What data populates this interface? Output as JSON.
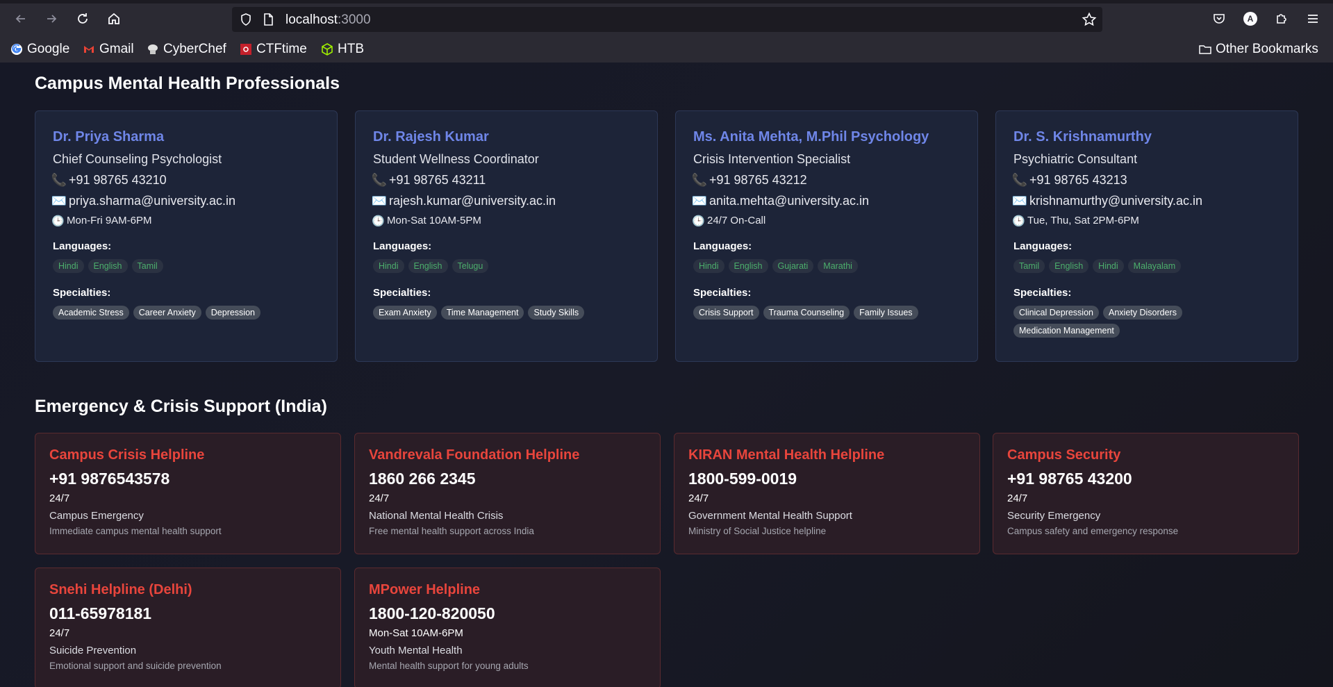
{
  "browser": {
    "url_host": "localhost",
    "url_port": ":3000",
    "bookmarks": [
      {
        "label": "Google",
        "icon": "google-icon"
      },
      {
        "label": "Gmail",
        "icon": "gmail-icon"
      },
      {
        "label": "CyberChef",
        "icon": "cyberchef-icon"
      },
      {
        "label": "CTFtime",
        "icon": "ctftime-icon"
      },
      {
        "label": "HTB",
        "icon": "htb-icon"
      }
    ],
    "other_bookmarks": "Other Bookmarks",
    "account_initial": "A"
  },
  "professionals": {
    "title": "Campus Mental Health Professionals",
    "languages_label": "Languages:",
    "specialties_label": "Specialties:",
    "items": [
      {
        "name": "Dr. Priya Sharma",
        "role": "Chief Counseling Psychologist",
        "phone": "+91 98765 43210",
        "email": "priya.sharma@university.ac.in",
        "hours": "Mon-Fri 9AM-6PM",
        "languages": [
          "Hindi",
          "English",
          "Tamil"
        ],
        "specialties": [
          "Academic Stress",
          "Career Anxiety",
          "Depression"
        ]
      },
      {
        "name": "Dr. Rajesh Kumar",
        "role": "Student Wellness Coordinator",
        "phone": "+91 98765 43211",
        "email": "rajesh.kumar@university.ac.in",
        "hours": "Mon-Sat 10AM-5PM",
        "languages": [
          "Hindi",
          "English",
          "Telugu"
        ],
        "specialties": [
          "Exam Anxiety",
          "Time Management",
          "Study Skills"
        ]
      },
      {
        "name": "Ms. Anita Mehta, M.Phil Psychology",
        "role": "Crisis Intervention Specialist",
        "phone": "+91 98765 43212",
        "email": "anita.mehta@university.ac.in",
        "hours": "24/7 On-Call",
        "languages": [
          "Hindi",
          "English",
          "Gujarati",
          "Marathi"
        ],
        "specialties": [
          "Crisis Support",
          "Trauma Counseling",
          "Family Issues"
        ]
      },
      {
        "name": "Dr. S. Krishnamurthy",
        "role": "Psychiatric Consultant",
        "phone": "+91 98765 43213",
        "email": "krishnamurthy@university.ac.in",
        "hours": "Tue, Thu, Sat 2PM-6PM",
        "languages": [
          "Tamil",
          "English",
          "Hindi",
          "Malayalam"
        ],
        "specialties": [
          "Clinical Depression",
          "Anxiety Disorders",
          "Medication Management"
        ]
      }
    ]
  },
  "emergency": {
    "title": "Emergency & Crisis Support (India)",
    "items": [
      {
        "name": "Campus Crisis Helpline",
        "phone": "+91 9876543578",
        "hours": "24/7",
        "type": "Campus Emergency",
        "desc": "Immediate campus mental health support"
      },
      {
        "name": "Vandrevala Foundation Helpline",
        "phone": "1860 266 2345",
        "hours": "24/7",
        "type": "National Mental Health Crisis",
        "desc": "Free mental health support across India"
      },
      {
        "name": "KIRAN Mental Health Helpline",
        "phone": "1800-599-0019",
        "hours": "24/7",
        "type": "Government Mental Health Support",
        "desc": "Ministry of Social Justice helpline"
      },
      {
        "name": "Campus Security",
        "phone": "+91 98765 43200",
        "hours": "24/7",
        "type": "Security Emergency",
        "desc": "Campus safety and emergency response"
      },
      {
        "name": "Snehi Helpline (Delhi)",
        "phone": "011-65978181",
        "hours": "24/7",
        "type": "Suicide Prevention",
        "desc": "Emotional support and suicide prevention"
      },
      {
        "name": "MPower Helpline",
        "phone": "1800-120-820050",
        "hours": "Mon-Sat 10AM-6PM",
        "type": "Youth Mental Health",
        "desc": "Mental health support for young adults"
      }
    ]
  }
}
